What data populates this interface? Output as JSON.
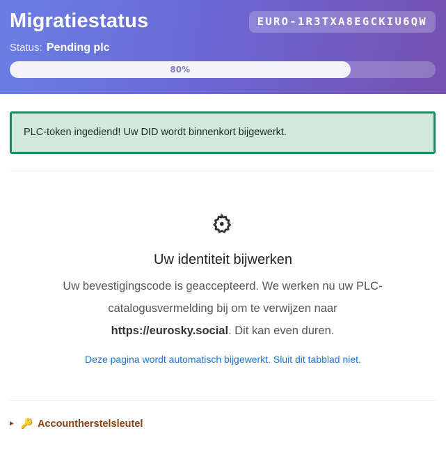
{
  "header": {
    "title": "Migratiestatus",
    "code": "EURO-1R3TXA8EGCKIU6QW",
    "status_label": "Status:",
    "status_value": "Pending plc",
    "progress_percent": 80,
    "progress_label": "80%"
  },
  "alert": {
    "message": "PLC-token ingediend! Uw DID wordt binnenkort bijgewerkt."
  },
  "main": {
    "icon": "gear-icon",
    "heading": "Uw identiteit bijwerken",
    "text_before": "Uw bevestigingscode is geaccepteerd. We werken nu uw PLC-catalogusvermelding bij om te verwijzen naar ",
    "text_link": "https://eurosky.social",
    "text_after": ". Dit kan even duren.",
    "note": "Deze pagina wordt automatisch bijgewerkt. Sluit dit tabblad niet."
  },
  "recovery": {
    "arrow_icon": "triangle-right-icon",
    "key_icon": "key-icon",
    "key_glyph": "🔑",
    "label": "Accountherstelsleutel"
  },
  "colors": {
    "header_gradient_start": "#6a7fe4",
    "header_gradient_end": "#7552b0",
    "alert_border": "#1f8a5b",
    "alert_bg": "#d2e8dc",
    "note_blue": "#1a73d8",
    "recovery_brown": "#8a3d12"
  }
}
